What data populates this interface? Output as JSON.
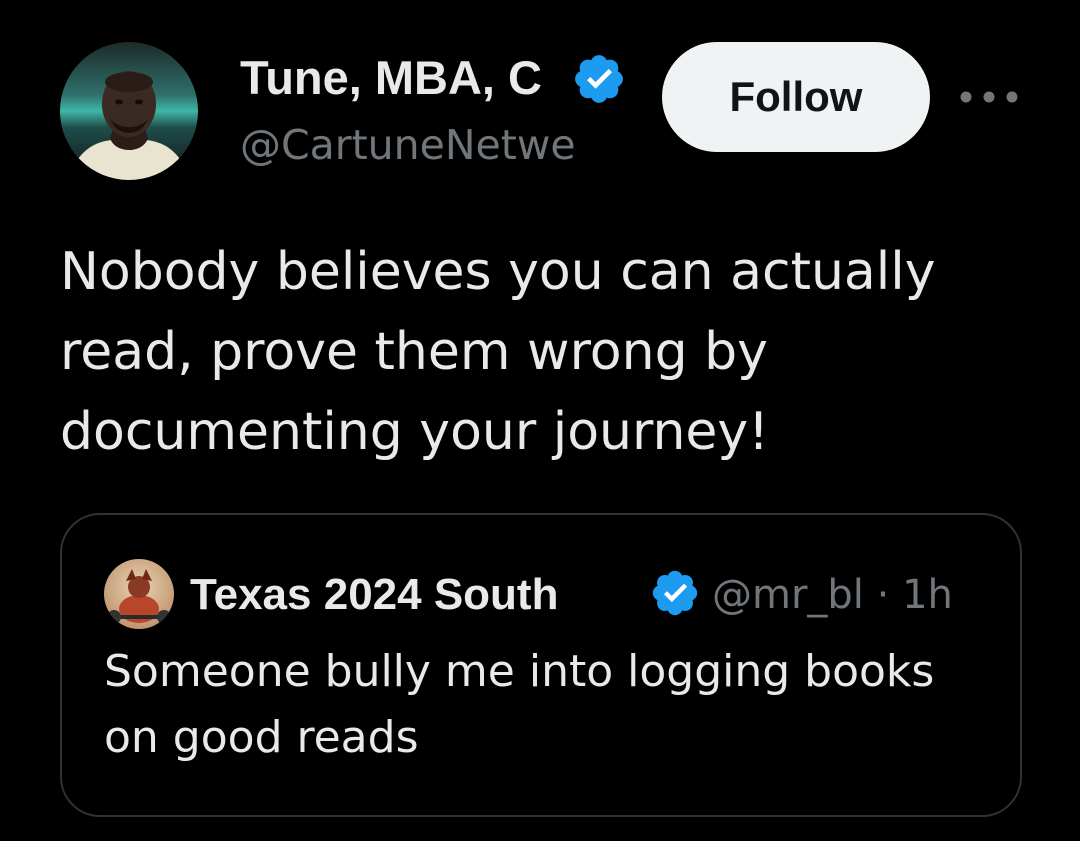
{
  "tweet": {
    "author": {
      "display_name": "Tune, MBA, C",
      "handle": "@CartuneNetwe",
      "avatar": "avatar-photo",
      "verified_icon": "verified-badge-icon"
    },
    "follow_label": "Follow",
    "more_icon": "more-horizontal-icon",
    "text": "Nobody believes you can actually read, prove them wrong by documenting your journey!"
  },
  "quoted_tweet": {
    "author": {
      "display_name": "Texas 2024 South",
      "handle": "@mr_bl",
      "avatar": "avatar-photo",
      "verified_icon": "verified-badge-icon"
    },
    "meta": " · 1h",
    "text": "Someone bully me into logging books on good reads"
  },
  "colors": {
    "background": "#000000",
    "primary_text": "#e7e9ea",
    "secondary_text": "#71767b",
    "verified_blue": "#1d9bf0",
    "follow_button_bg": "#eff3f4",
    "border": "#2f3336"
  }
}
